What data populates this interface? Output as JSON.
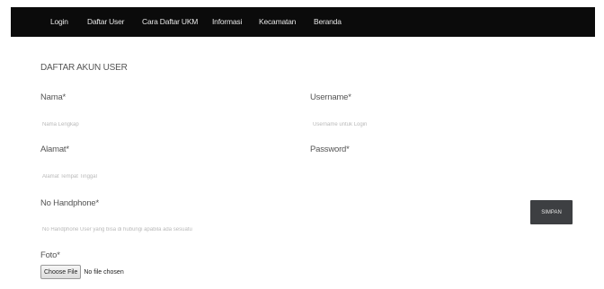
{
  "nav": {
    "items": [
      {
        "label": "Login"
      },
      {
        "label": "Daftar User"
      },
      {
        "label": "Cara Daftar UKM"
      },
      {
        "label": "Informasi"
      },
      {
        "label": "Kecamatan"
      },
      {
        "label": "Beranda"
      }
    ]
  },
  "form": {
    "title": "DAFTAR AKUN USER",
    "nama": {
      "label": "Nama*",
      "placeholder": "Nama Lengkap"
    },
    "username": {
      "label": "Username*",
      "placeholder": "Username untuk Login"
    },
    "alamat": {
      "label": "Alamat*",
      "placeholder": "Alamat Tempat Tinggal"
    },
    "password": {
      "label": "Password*",
      "placeholder": ""
    },
    "handphone": {
      "label": "No Handphone*",
      "placeholder": "No Handphone User yang bisa di hubungi apabila ada sesuatu"
    },
    "foto": {
      "label": "Foto*",
      "button": "Choose File",
      "status": "No file chosen"
    },
    "save_label": "SIMPAN"
  }
}
